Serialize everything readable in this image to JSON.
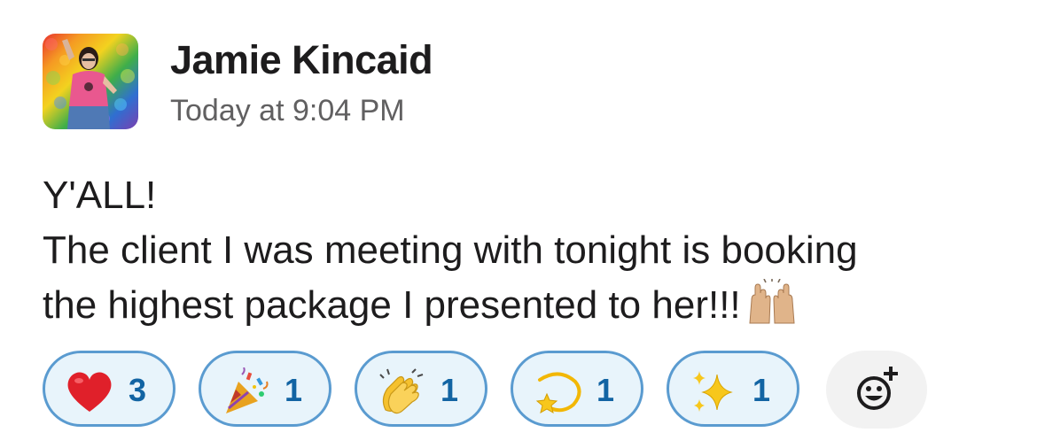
{
  "message": {
    "sender_name": "Jamie Kincaid",
    "timestamp": "Today at 9:04 PM",
    "lines": [
      "Y'ALL!",
      "The client I was meeting with tonight is booking",
      "the highest package I presented to her!!!"
    ],
    "inline_emoji": "raising-hands-emoji"
  },
  "reactions": [
    {
      "emoji": "red-heart",
      "count": "3"
    },
    {
      "emoji": "party-popper",
      "count": "1"
    },
    {
      "emoji": "clapping-hands",
      "count": "1"
    },
    {
      "emoji": "dizzy-star",
      "count": "1"
    },
    {
      "emoji": "sparkles",
      "count": "1"
    }
  ],
  "add_reaction": {
    "icon": "add-reaction-icon"
  },
  "colors": {
    "reaction_border": "#5a9bd0",
    "reaction_bg": "#e8f4fb",
    "reaction_count": "#1264a3",
    "timestamp": "#616061"
  }
}
